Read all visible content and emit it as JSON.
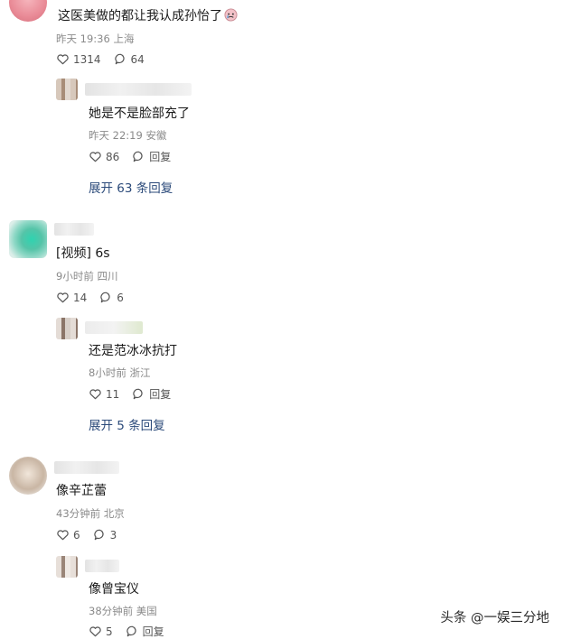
{
  "comments": [
    {
      "text": "这医美做的都让我认成孙怡了",
      "meta": "昨天 19:36 上海",
      "likes": "1314",
      "replies": "64",
      "reply": {
        "text": "她是不是脸部充了",
        "meta": "昨天 22:19 安徽",
        "likes": "86",
        "reply_label": "回复"
      },
      "expand": "展开 63 条回复"
    },
    {
      "text": "[视频] 6s",
      "meta": "9小时前 四川",
      "likes": "14",
      "replies": "6",
      "reply": {
        "text": "还是范冰冰抗打",
        "meta": "8小时前 浙江",
        "likes": "11",
        "reply_label": "回复"
      },
      "expand": "展开 5 条回复"
    },
    {
      "text": "像辛芷蕾",
      "meta": "43分钟前 北京",
      "likes": "6",
      "replies": "3",
      "reply": {
        "text": "像曾宝仪",
        "meta": "38分钟前 美国",
        "likes": "5",
        "reply_label": "回复"
      }
    }
  ],
  "watermark": "头条 @一娱三分地",
  "icons": {
    "like": "heart-outline-icon",
    "comment": "speech-bubble-icon",
    "emoji": "crying-face-emoji-icon"
  },
  "colors": {
    "expand_link": "#2b4a7a",
    "meta_text": "#8a8a8a"
  }
}
